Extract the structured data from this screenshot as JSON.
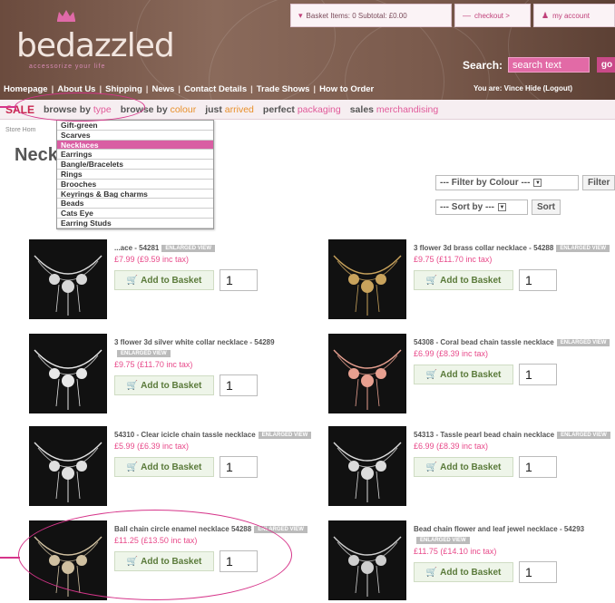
{
  "header": {
    "logo": "bedazzled",
    "tagline": "accessorize your life",
    "basket_label": "Basket Items: 0 Subtotal: £0.00",
    "checkout_label": "checkout >",
    "account_label": "my account",
    "search_label": "Search:",
    "search_value": "search text",
    "search_go": "go"
  },
  "nav": {
    "items": [
      "Homepage",
      "About Us",
      "Shipping",
      "News",
      "Contact Details",
      "Trade Shows",
      "How to Order"
    ],
    "you_are": "You are: Vince Hide (Logout)"
  },
  "subnav": {
    "sale": "SALE",
    "browse_type_a": "browse by ",
    "browse_type_b": "type",
    "browse_colour_a": "browse by ",
    "browse_colour_b": "colour",
    "just_a": "just ",
    "just_b": "arrived",
    "perfect_a": "perfect ",
    "perfect_b": "packaging",
    "sales_a": "sales ",
    "sales_b": "merchandising"
  },
  "breadcrumb": "Store Hom",
  "page_title": "Neck",
  "dropdown": {
    "options": [
      "Gift-green",
      "Scarves",
      "Necklaces",
      "Earrings",
      "Bangle/Bracelets",
      "Rings",
      "Brooches",
      "Keyrings & Bag charms",
      "Beads",
      "Cats Eye",
      "Earring Studs"
    ],
    "selected_index": 2
  },
  "filters": {
    "colour_select": "--- Filter by Colour ---",
    "filter_button": "Filter",
    "sort_select": "--- Sort by ---",
    "sort_button": "Sort"
  },
  "products": [
    {
      "name": "...ace - 54281",
      "badge": "ENLARGED VIEW",
      "price": "£7.99 (£9.59 inc tax)",
      "add_label": "Add to Basket",
      "qty": "1"
    },
    {
      "name": "3 flower 3d brass collar necklace - 54288",
      "badge": "ENLARGED VIEW",
      "price": "£9.75 (£11.70 inc tax)",
      "add_label": "Add to Basket",
      "qty": "1"
    },
    {
      "name": "3 flower 3d silver white collar necklace - 54289",
      "badge": "ENLARGED VIEW",
      "price": "£9.75 (£11.70 inc tax)",
      "add_label": "Add to Basket",
      "qty": "1"
    },
    {
      "name": "54308 - Coral bead chain tassle necklace",
      "badge": "ENLARGED VIEW",
      "price": "£6.99 (£8.39 inc tax)",
      "add_label": "Add to Basket",
      "qty": "1"
    },
    {
      "name": "54310 - Clear icicle chain tassle necklace",
      "badge": "ENLARGED VIEW",
      "price": "£5.99 (£6.39 inc tax)",
      "add_label": "Add to Basket",
      "qty": "1"
    },
    {
      "name": "54313 - Tassle pearl bead chain necklace",
      "badge": "ENLARGED VIEW",
      "price": "£6.99 (£8.39 inc tax)",
      "add_label": "Add to Basket",
      "qty": "1"
    },
    {
      "name": "Ball chain circle enamel necklace 54288",
      "badge": "ENLARGED VIEW",
      "price": "£11.25 (£13.50 inc tax)",
      "add_label": "Add to Basket",
      "qty": "1"
    },
    {
      "name": "Bead chain flower and leaf jewel necklace - 54293",
      "badge": "ENLARGED VIEW",
      "price": "£11.75 (£14.10 inc tax)",
      "add_label": "Add to Basket",
      "qty": "1"
    }
  ],
  "colors": {
    "header_brown": "#7a5a4c",
    "pink_accent": "#e15a9a",
    "sale_red": "#c8254e",
    "annotation_pink": "#d6358a"
  }
}
